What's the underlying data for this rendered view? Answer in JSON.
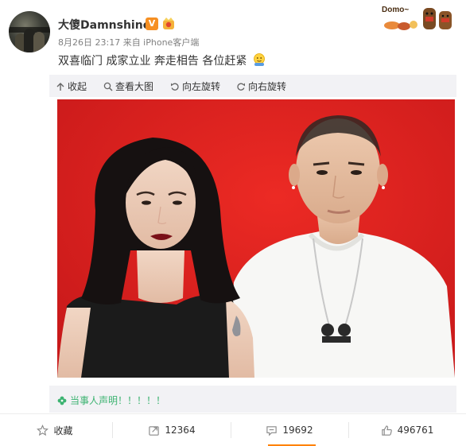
{
  "header": {
    "username": "大傻Damnshine",
    "verified_badge": "V",
    "meta": "8月26日 23:17 来自 iPhone客户端",
    "post_text": "双喜临门 成家立业 奔走相告 各位赶紧",
    "sticker_text": "Domo~"
  },
  "toolbar": {
    "collapse": "收起",
    "view_large": "查看大图",
    "rotate_left": "向左旋转",
    "rotate_right": "向右旋转"
  },
  "statement": {
    "text": "当事人声明！！！！！"
  },
  "actions": {
    "favorite_label": "收藏",
    "repost_count": "12364",
    "comment_count": "19692",
    "like_count": "496761"
  },
  "colors": {
    "accent": "#ff8200",
    "verified": "#f68f22",
    "statement": "#3cb371",
    "photo_bg": "#e0231e"
  },
  "icons": [
    "crown-icon",
    "emoji-icon",
    "collapse-icon",
    "zoom-icon",
    "rotate-left-icon",
    "rotate-right-icon",
    "clover-icon",
    "star-icon",
    "repost-icon",
    "comment-icon",
    "like-icon"
  ]
}
